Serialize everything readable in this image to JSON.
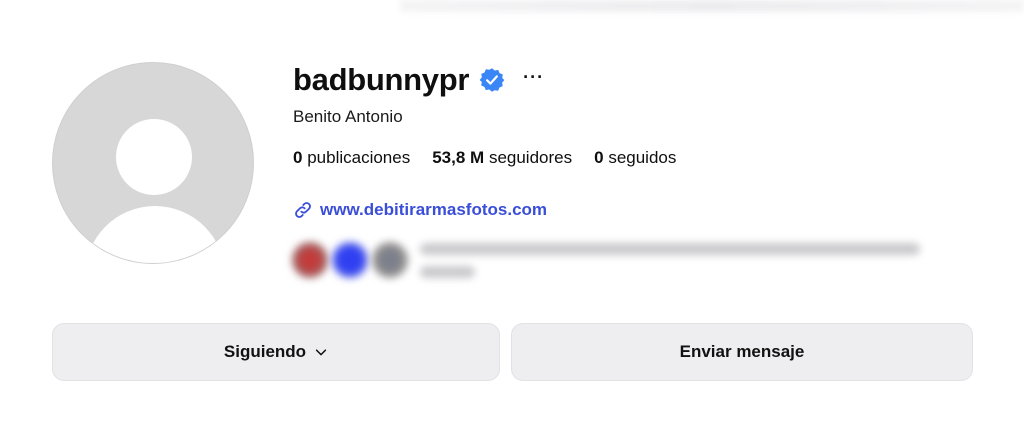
{
  "profile": {
    "username": "badbunnypr",
    "verified": true,
    "full_name": "Benito Antonio",
    "more_label": "···",
    "stats": {
      "posts_count": "0",
      "posts_label": "publicaciones",
      "followers_count": "53,8 M",
      "followers_label": "seguidores",
      "following_count": "0",
      "following_label": "seguidos"
    },
    "link": "www.debitirarmasfotos.com"
  },
  "actions": {
    "following_label": "Siguiendo",
    "message_label": "Enviar mensaje"
  },
  "colors": {
    "link": "#3a4ed8",
    "verified_badge": "#3a86f6",
    "button_bg": "#eeeef0"
  },
  "icons": {
    "verified": "verified-badge-icon",
    "link": "link-icon",
    "chevron": "chevron-down-icon",
    "more": "more-options-icon"
  }
}
